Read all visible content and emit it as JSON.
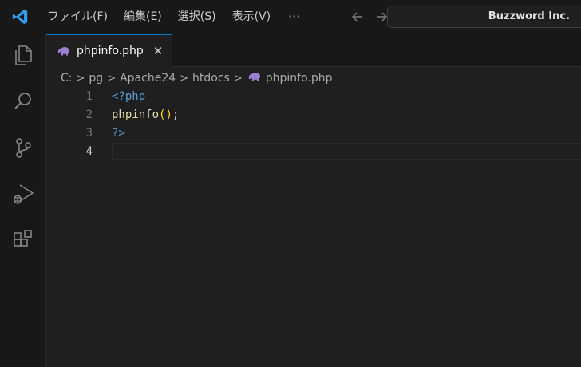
{
  "menu": {
    "items": [
      "ファイル(F)",
      "編集(E)",
      "選択(S)",
      "表示(V)"
    ],
    "more": "···"
  },
  "command_center": {
    "title": "Buzzword Inc."
  },
  "tab": {
    "label": "phpinfo.php",
    "close": "✕"
  },
  "breadcrumb": [
    "C:",
    "pg",
    "Apache24",
    "htdocs",
    "phpinfo.php"
  ],
  "editor": {
    "lines": [
      {
        "number": "1",
        "open_tag": "<?php"
      },
      {
        "number": "2",
        "fn": "phpinfo",
        "paren": "()",
        "end": ";"
      },
      {
        "number": "3",
        "close_tag": "?>"
      },
      {
        "number": "4"
      }
    ]
  },
  "colors": {
    "accent": "#0078d4",
    "php_icon": "#9b7fd1",
    "logo": "#2f9ef4"
  }
}
